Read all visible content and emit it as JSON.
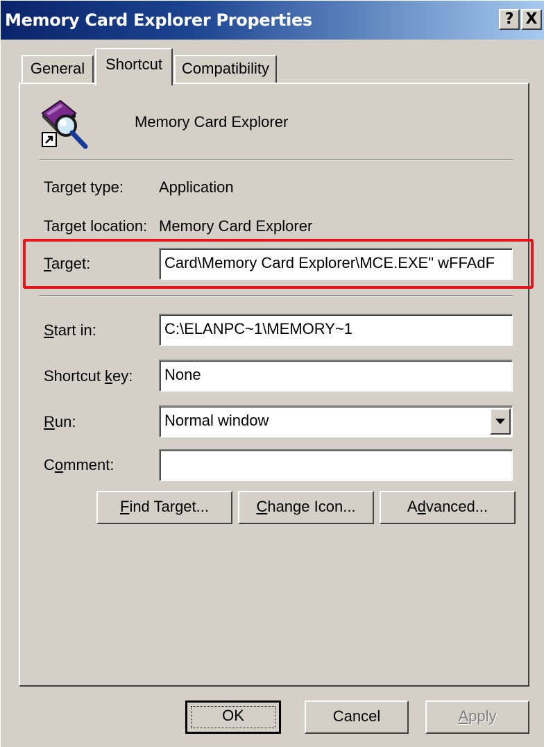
{
  "window": {
    "title": "Memory Card Explorer Properties",
    "help_label": "?",
    "close_label": "X"
  },
  "tabs": [
    {
      "label": "General",
      "active": false
    },
    {
      "label": "Shortcut",
      "active": true
    },
    {
      "label": "Compatibility",
      "active": false
    }
  ],
  "shortcut": {
    "app_name": "Memory Card Explorer",
    "icon": "memory-card-magnifier-icon",
    "target_type_label": "Target type:",
    "target_type_value": "Application",
    "target_location_label": "Target location:",
    "target_location_value": "Memory Card Explorer",
    "target_label_prefix": "",
    "target_label_accel": "T",
    "target_label_rest": "arget:",
    "target_value": "Card\\Memory Card Explorer\\MCE.EXE\" wFFAdF",
    "start_in_label_accel": "S",
    "start_in_label_rest": "tart in:",
    "start_in_value": "C:\\ELANPC~1\\MEMORY~1",
    "shortcut_key_label_prefix": "Shortcut ",
    "shortcut_key_label_accel": "k",
    "shortcut_key_label_rest": "ey:",
    "shortcut_key_value": "None",
    "run_label_accel": "R",
    "run_label_rest": "un:",
    "run_value": "Normal window",
    "comment_label_prefix": "C",
    "comment_label_accel": "o",
    "comment_label_rest": "mment:",
    "comment_value": ""
  },
  "buttons": {
    "find_target_accel": "F",
    "find_target_rest": "ind Target...",
    "change_icon_accel": "C",
    "change_icon_rest": "hange Icon...",
    "advanced_prefix": "A",
    "advanced_accel": "d",
    "advanced_rest": "vanced...",
    "ok": "OK",
    "cancel": "Cancel",
    "apply_accel": "A",
    "apply_rest": "pply"
  },
  "colors": {
    "highlight_box": "#e8141c",
    "title_bar": "#0a246a",
    "dialog_face": "#d4d0c8"
  }
}
